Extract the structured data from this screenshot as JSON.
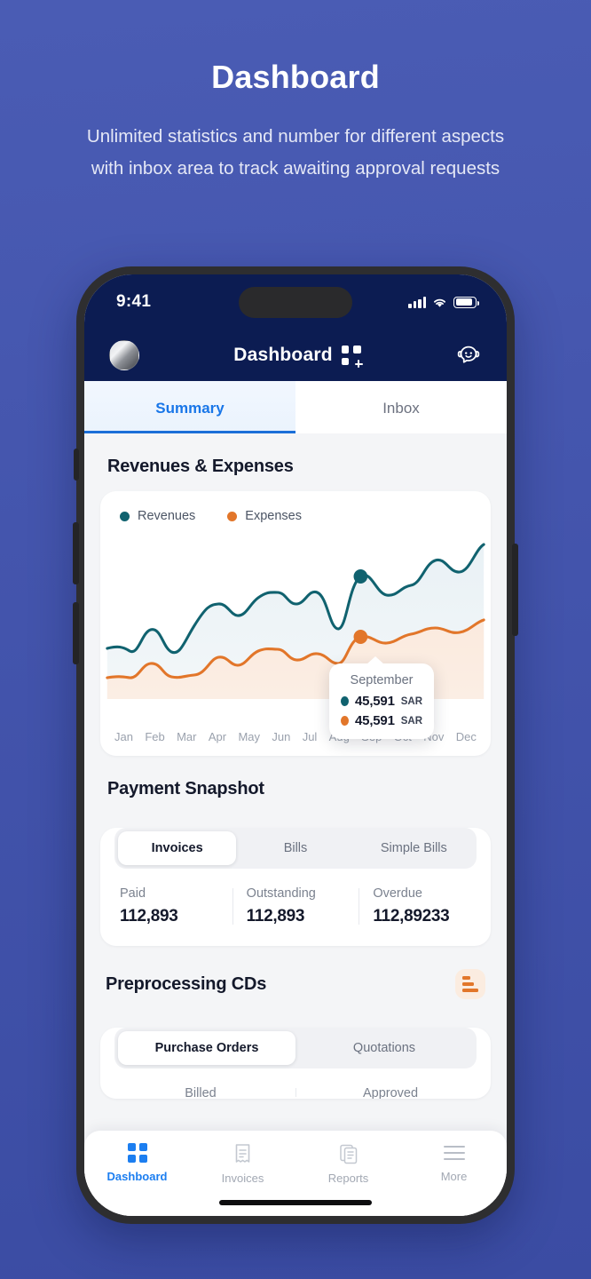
{
  "promo": {
    "title": "Dashboard",
    "subtitle": "Unlimited statistics and number for different aspects with inbox area to track awaiting approval requests"
  },
  "colors": {
    "background_top": "#4a5cb4",
    "background_bottom": "#3b4ca3",
    "navbar": "#0c1c52",
    "accent_blue": "#1c7ef0",
    "revenues_teal": "#10626f",
    "expenses_orange": "#e2762a"
  },
  "status_bar": {
    "time": "9:41",
    "signal_icon": "signal-bars-icon",
    "wifi_icon": "wifi-icon",
    "battery_icon": "battery-icon"
  },
  "navbar": {
    "avatar_icon": "user-avatar",
    "title": "Dashboard",
    "title_icon": "grid-plus-icon",
    "support_icon": "support-chat-icon"
  },
  "tabs": [
    {
      "label": "Summary",
      "active": true
    },
    {
      "label": "Inbox",
      "active": false
    }
  ],
  "revenues_expenses": {
    "title": "Revenues & Expenses",
    "legend": [
      {
        "label": "Revenues",
        "color": "#10626f"
      },
      {
        "label": "Expenses",
        "color": "#e2762a"
      }
    ],
    "tooltip": {
      "month": "September",
      "revenues_value": "45,591",
      "revenues_currency": "SAR",
      "expenses_value": "45,591",
      "expenses_currency": "SAR"
    }
  },
  "chart_data": {
    "type": "area",
    "title": "Revenues & Expenses",
    "xlabel": "",
    "ylabel": "",
    "categories": [
      "Jan",
      "Feb",
      "Mar",
      "Apr",
      "May",
      "Jun",
      "Jul",
      "Aug",
      "Sep",
      "Oct",
      "Nov",
      "Dec"
    ],
    "series": [
      {
        "name": "Revenues",
        "color": "#10626f",
        "values": [
          38,
          46,
          34,
          52,
          49,
          61,
          57,
          45,
          74,
          69,
          80,
          88
        ]
      },
      {
        "name": "Expenses",
        "color": "#e2762a",
        "values": [
          20,
          27,
          19,
          33,
          30,
          40,
          38,
          36,
          47,
          46,
          52,
          57
        ]
      }
    ],
    "highlight": {
      "category": "Sep",
      "revenues": "45,591 SAR",
      "expenses": "45,591 SAR"
    },
    "ylim": [
      0,
      100
    ],
    "grid": false,
    "legend_position": "top-left"
  },
  "payment_snapshot": {
    "title": "Payment Snapshot",
    "segments": [
      {
        "label": "Invoices",
        "active": true
      },
      {
        "label": "Bills",
        "active": false
      },
      {
        "label": "Simple Bills",
        "active": false
      }
    ],
    "stats": [
      {
        "label": "Paid",
        "value": "112,893"
      },
      {
        "label": "Outstanding",
        "value": "112,893"
      },
      {
        "label": "Overdue",
        "value": "112,89233"
      }
    ]
  },
  "preprocessing": {
    "title": "Preprocessing CDs",
    "icon": "bar-chart-icon",
    "segments": [
      {
        "label": "Purchase Orders",
        "active": true
      },
      {
        "label": "Quotations",
        "active": false
      }
    ],
    "stats": [
      {
        "label": "Billed"
      },
      {
        "label": "Approved"
      }
    ]
  },
  "bottom_tabs": [
    {
      "label": "Dashboard",
      "icon": "grid-icon",
      "active": true
    },
    {
      "label": "Invoices",
      "icon": "receipt-icon",
      "active": false
    },
    {
      "label": "Reports",
      "icon": "documents-icon",
      "active": false
    },
    {
      "label": "More",
      "icon": "hamburger-icon",
      "active": false
    }
  ]
}
